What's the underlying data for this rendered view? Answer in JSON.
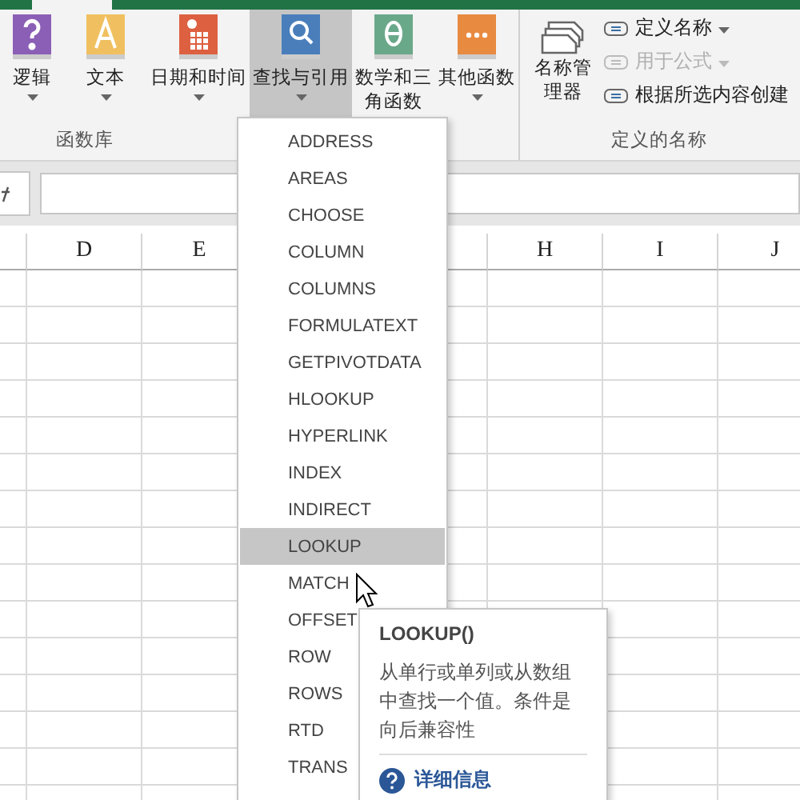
{
  "ribbon": {
    "function_library": {
      "buttons": [
        {
          "label": "逻辑",
          "color": "#8b5fb5",
          "kind": "question",
          "selected": false
        },
        {
          "label": "文本",
          "color": "#f0c060",
          "kind": "letter",
          "selected": false
        },
        {
          "label": "日期和时间",
          "color": "#dd6040",
          "kind": "calendar",
          "selected": false
        },
        {
          "label": "查找与引用",
          "color": "#4a7ebb",
          "kind": "search",
          "selected": true
        },
        {
          "label": "数学和三角函数",
          "color": "#6aa88a",
          "kind": "theta",
          "selected": false
        },
        {
          "label": "其他函数",
          "color": "#e88a40",
          "kind": "dots",
          "selected": false
        }
      ],
      "group_label": "函数库"
    },
    "defined_names": {
      "name_manager": "名称管理器",
      "items": [
        {
          "label": "定义名称",
          "disabled": false,
          "dropdown": true
        },
        {
          "label": "用于公式",
          "disabled": true,
          "dropdown": true
        },
        {
          "label": "根据所选内容创建",
          "disabled": false,
          "dropdown": false
        }
      ],
      "group_label": "定义的名称"
    }
  },
  "sheet": {
    "columns_left": [
      "D",
      "E"
    ],
    "columns_right": [
      "H",
      "I",
      "J"
    ]
  },
  "dropdown_menu": {
    "items": [
      {
        "label": "ADDRESS",
        "selected": false
      },
      {
        "label": "AREAS",
        "selected": false
      },
      {
        "label": "CHOOSE",
        "selected": false
      },
      {
        "label": "COLUMN",
        "selected": false
      },
      {
        "label": "COLUMNS",
        "selected": false
      },
      {
        "label": "FORMULATEXT",
        "selected": false
      },
      {
        "label": "GETPIVOTDATA",
        "selected": false
      },
      {
        "label": "HLOOKUP",
        "selected": false
      },
      {
        "label": "HYPERLINK",
        "selected": false
      },
      {
        "label": "INDEX",
        "selected": false
      },
      {
        "label": "INDIRECT",
        "selected": false
      },
      {
        "label": "LOOKUP",
        "selected": true
      },
      {
        "label": "MATCH",
        "selected": false
      },
      {
        "label": "OFFSET",
        "selected": false
      },
      {
        "label": "ROW",
        "selected": false
      },
      {
        "label": "ROWS",
        "selected": false
      },
      {
        "label": "RTD",
        "selected": false
      },
      {
        "label": "TRANS",
        "selected": false
      }
    ]
  },
  "tooltip": {
    "title": "LOOKUP()",
    "description": "从单行或单列或从数组中查找一个值。条件是向后兼容性",
    "link": "详细信息"
  }
}
